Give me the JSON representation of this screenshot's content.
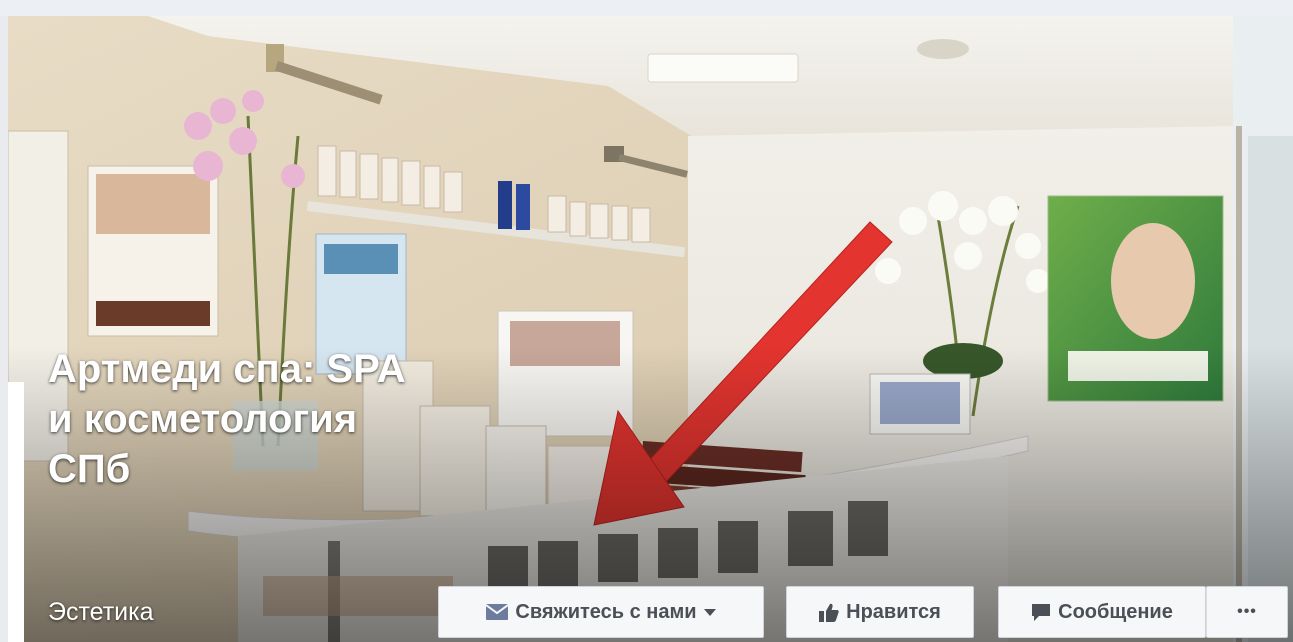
{
  "page": {
    "title": "Артмеди спа: SPA и косметология СПб",
    "category": "Эстетика"
  },
  "actions": {
    "contact_label": "Свяжитесь с нами",
    "like_label": "Нравится",
    "message_label": "Сообщение",
    "more_label": "•••"
  },
  "icons": {
    "contact": "envelope-icon",
    "like": "thumbs-up-icon",
    "message": "speech-bubble-icon",
    "more": "ellipsis-icon",
    "dropdown": "caret-down-icon"
  },
  "colors": {
    "button_bg": "#f6f7f9",
    "button_text": "#4b4f56",
    "arrow_red": "#e3342f",
    "title_text": "#ffffff"
  }
}
